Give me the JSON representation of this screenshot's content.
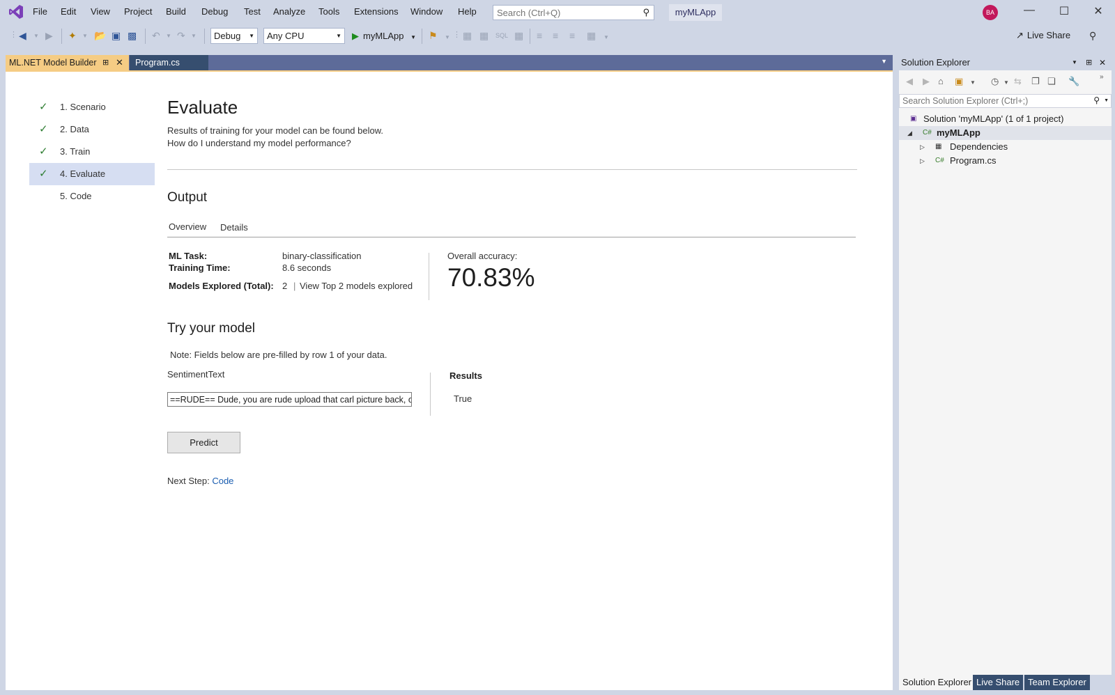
{
  "menu": {
    "items": [
      "File",
      "Edit",
      "View",
      "Project",
      "Build",
      "Debug",
      "Test",
      "Analyze",
      "Tools",
      "Extensions",
      "Window",
      "Help"
    ],
    "search_placeholder": "Search (Ctrl+Q)",
    "solution_name": "myMLApp",
    "avatar_initials": "BA"
  },
  "toolbar": {
    "config": "Debug",
    "platform": "Any CPU",
    "run_target": "myMLApp",
    "live_share": "Live Share"
  },
  "doc_tabs": {
    "active": "ML.NET Model Builder",
    "inactive": "Program.cs"
  },
  "steps": [
    {
      "label": "1. Scenario",
      "done": true
    },
    {
      "label": "2. Data",
      "done": true
    },
    {
      "label": "3. Train",
      "done": true
    },
    {
      "label": "4. Evaluate",
      "done": true,
      "active": true
    },
    {
      "label": "5. Code",
      "done": false
    }
  ],
  "evaluate": {
    "title": "Evaluate",
    "subtitle": "Results of training for your model can be found below.",
    "help_link": "How do I understand my model performance?",
    "output_heading": "Output",
    "tabs": [
      "Overview",
      "Details"
    ],
    "ml_task_label": "ML Task:",
    "ml_task_value": "binary-classification",
    "training_time_label": "Training Time:",
    "training_time_value": "8.6 seconds",
    "models_explored_label": "Models Explored (Total):",
    "models_explored_value": "2",
    "models_separator": "|",
    "view_models_link": "View Top 2 models explored",
    "accuracy_label": "Overall accuracy:",
    "accuracy_value": "70.83%",
    "try_heading": "Try your model",
    "note": "Note: Fields below are pre-filled by row 1 of your data.",
    "field_label": "SentimentText",
    "field_value": "==RUDE== Dude, you are rude upload that carl picture back, or else.",
    "results_heading": "Results",
    "results_value": "True",
    "predict_label": "Predict",
    "next_step_label": "Next Step:",
    "next_step_link": "Code"
  },
  "solution_explorer": {
    "title": "Solution Explorer",
    "search_placeholder": "Search Solution Explorer (Ctrl+;)",
    "solution": "Solution 'myMLApp' (1 of 1 project)",
    "project": "myMLApp",
    "dependencies": "Dependencies",
    "program": "Program.cs",
    "bottom_tabs": [
      "Solution Explorer",
      "Live Share",
      "Team Explorer"
    ]
  },
  "colors": {
    "accent_tab": "#f5cc84",
    "chrome": "#cfd6e5",
    "link": "#1a5db0",
    "check": "#2e7d32"
  }
}
